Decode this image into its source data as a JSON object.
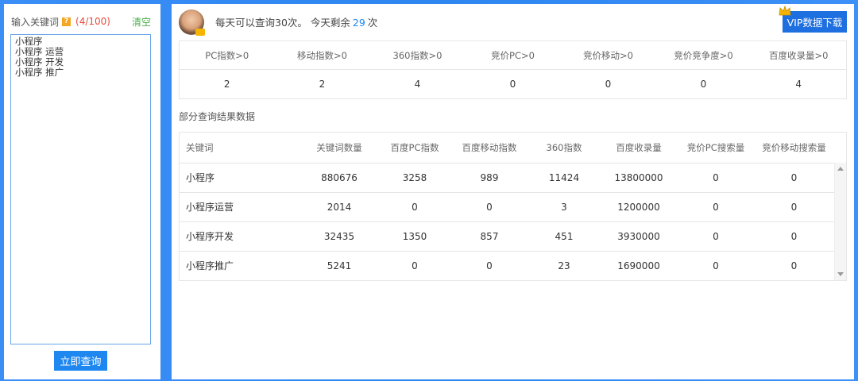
{
  "left": {
    "title": "输入关键词",
    "count": "(4/100)",
    "clear_label": "清空",
    "keywords_text": "小程序\n小程序 运营\n小程序 开发\n小程序 推广",
    "query_label": "立即查询"
  },
  "header": {
    "notice_prefix": "每天可以查询30次。 今天剩余",
    "remaining": "29",
    "notice_suffix": "次",
    "vip_label": "VIP数据下载"
  },
  "summary": {
    "headers": [
      "PC指数>0",
      "移动指数>0",
      "360指数>0",
      "竞价PC>0",
      "竞价移动>0",
      "竞价竞争度>0",
      "百度收录量>0"
    ],
    "values": [
      "2",
      "2",
      "4",
      "0",
      "0",
      "0",
      "4"
    ]
  },
  "section_title": "部分查询结果数据",
  "results": {
    "headers": [
      "关键词",
      "关键词数量",
      "百度PC指数",
      "百度移动指数",
      "360指数",
      "百度收录量",
      "竞价PC搜索量",
      "竞价移动搜索量"
    ],
    "rows": [
      [
        "小程序",
        "880676",
        "3258",
        "989",
        "11424",
        "13800000",
        "0",
        "0"
      ],
      [
        "小程序运营",
        "2014",
        "0",
        "0",
        "3",
        "1200000",
        "0",
        "0"
      ],
      [
        "小程序开发",
        "32435",
        "1350",
        "857",
        "451",
        "3930000",
        "0",
        "0"
      ],
      [
        "小程序推广",
        "5241",
        "0",
        "0",
        "23",
        "1690000",
        "0",
        "0"
      ]
    ]
  },
  "colors": {
    "accent": "#1e87f0",
    "count": "#e84b3c",
    "clear": "#4cae4c",
    "background": "#2f86f0"
  }
}
